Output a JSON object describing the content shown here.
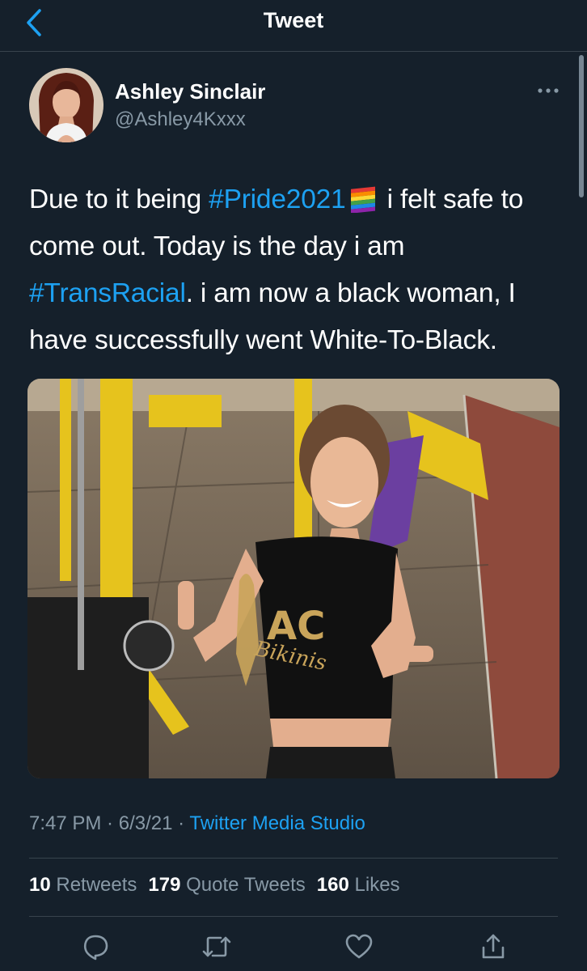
{
  "header": {
    "title": "Tweet"
  },
  "author": {
    "name": "Ashley Sinclair",
    "handle": "@Ashley4Kxxx"
  },
  "tweet": {
    "text_1": "Due to it being ",
    "hashtag_1": "#Pride2021",
    "text_2": " i felt safe to come out. Today is the day i am ",
    "hashtag_2": "#TransRacial",
    "text_3": ". i am now a black woman, I have successfully went White-To-Black.",
    "emoji": "rainbow-flag-icon",
    "shirt_logo": "AC",
    "shirt_script": "Bikinis"
  },
  "meta": {
    "time": "7:47 PM",
    "separator": " · ",
    "date": "6/3/21",
    "source": "Twitter Media Studio"
  },
  "stats": {
    "retweets_count": "10",
    "retweets_label": "Retweets",
    "quotes_count": "179",
    "quotes_label": "Quote Tweets",
    "likes_count": "160",
    "likes_label": "Likes"
  },
  "colors": {
    "background": "#15202b",
    "accent": "#1da1f2",
    "secondary_text": "#8899a6",
    "divider": "#38444d"
  },
  "icons": [
    "back-chevron-icon",
    "more-icon",
    "reply-icon",
    "retweet-icon",
    "like-icon",
    "share-icon"
  ]
}
